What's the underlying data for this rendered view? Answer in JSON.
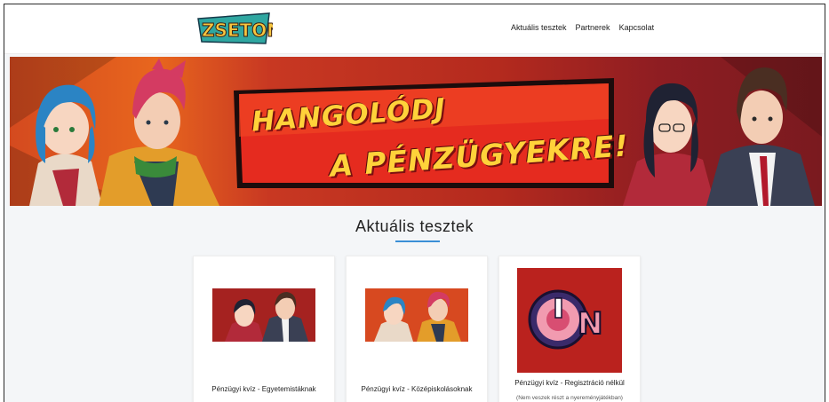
{
  "header": {
    "logo_text": "ZSETON",
    "nav": [
      {
        "label": "Aktuális tesztek"
      },
      {
        "label": "Partnerek"
      },
      {
        "label": "Kapcsolat"
      }
    ]
  },
  "banner": {
    "line1": "HANGOLÓDJ",
    "line2": "A PÉNZÜGYEKRE!"
  },
  "section": {
    "title": "Aktuális tesztek"
  },
  "cards": [
    {
      "label": "Pénzügyi kvíz - Egyetemistáknak"
    },
    {
      "label": "Pénzügyi kvíz - Középiskolásoknak"
    },
    {
      "label": "Pénzügyi kvíz - Regisztráció nélkül",
      "sublabel": "(Nem veszek részt a nyereményjátékban)",
      "badge_text": "ON"
    }
  ],
  "colors": {
    "accent": "#3a8fd6",
    "banner_red": "#c83822",
    "headline_yellow": "#ffd23a"
  }
}
